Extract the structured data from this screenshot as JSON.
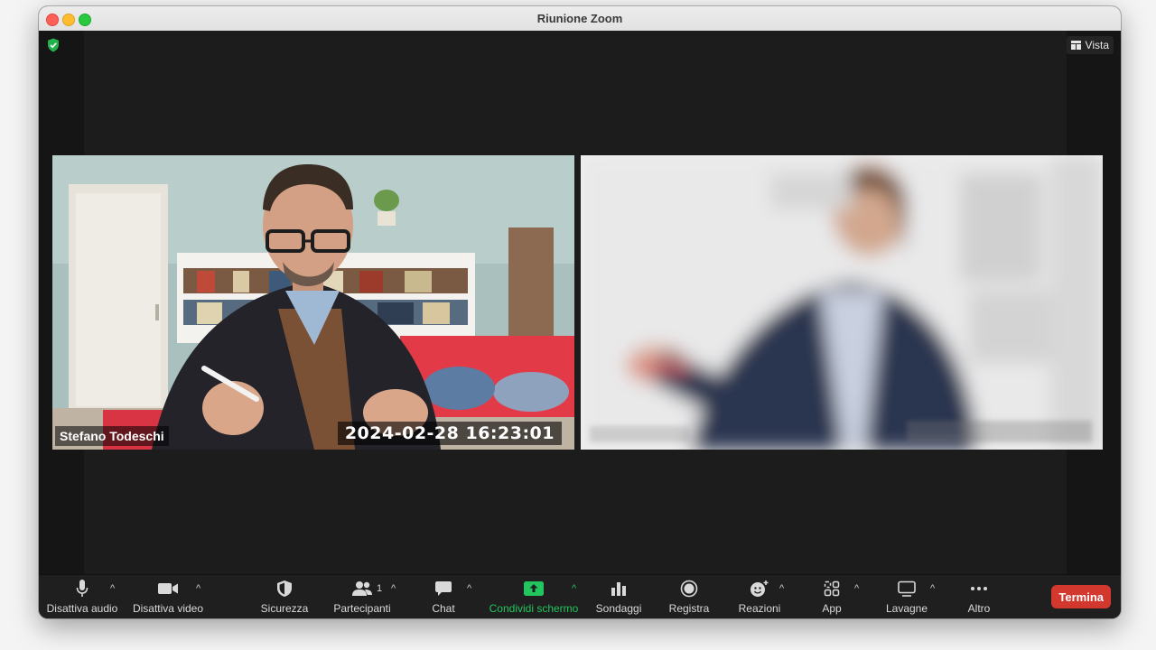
{
  "window": {
    "title": "Riunione Zoom"
  },
  "top_bar": {
    "view_label": "Vista",
    "encryption_icon": "shield-check-icon"
  },
  "participants": [
    {
      "name": "Stefano Todeschi",
      "timestamp": "2024-02-28  16:23:01"
    },
    {
      "name": ""
    }
  ],
  "toolbar": {
    "mute": {
      "label": "Disattiva audio",
      "icon": "microphone-icon"
    },
    "video": {
      "label": "Disattiva video",
      "icon": "video-camera-icon"
    },
    "security": {
      "label": "Sicurezza",
      "icon": "shield-icon"
    },
    "participants": {
      "label": "Partecipanti",
      "count": "1",
      "icon": "people-icon"
    },
    "chat": {
      "label": "Chat",
      "icon": "chat-bubble-icon"
    },
    "share": {
      "label": "Condividi schermo",
      "icon": "share-screen-icon",
      "color": "#22c55e"
    },
    "polls": {
      "label": "Sondaggi",
      "icon": "bar-chart-icon"
    },
    "record": {
      "label": "Registra",
      "icon": "record-icon"
    },
    "reactions": {
      "label": "Reazioni",
      "icon": "emoji-plus-icon"
    },
    "apps": {
      "label": "App",
      "icon": "apps-icon"
    },
    "whiteboards": {
      "label": "Lavagne",
      "icon": "whiteboard-icon"
    },
    "more": {
      "label": "Altro",
      "icon": "ellipsis-icon"
    },
    "end": {
      "label": "Termina",
      "color": "#d3382f"
    }
  }
}
